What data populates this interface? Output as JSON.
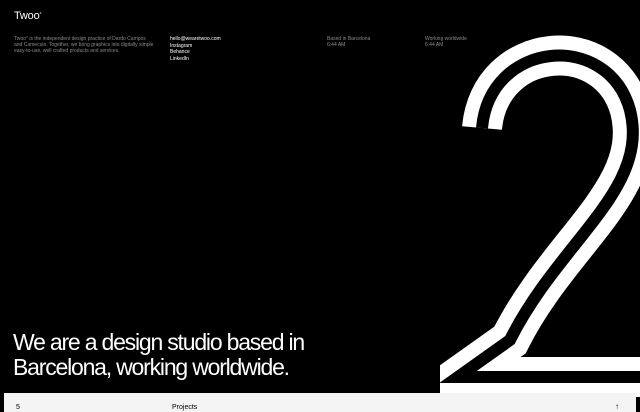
{
  "brand": {
    "name": "Twoo",
    "mark": "°"
  },
  "about": "Twoo° is the independent design practice of Dardo Campos and Camecuin. Together, we bring graphics into digitally simple easy-to-use, well crafted products and services.",
  "contacts": [
    "hello@wearetwoo.com",
    "Instagram",
    "Behance",
    "LinkedIn"
  ],
  "location": {
    "label": "Based in Barcelona",
    "time": "6:44 AM"
  },
  "worldwide": {
    "label": "Working worldwide",
    "time": "6:44 AM"
  },
  "hero": {
    "line1": "We are a design studio based in",
    "line2": "Barcelona, working worldwide."
  },
  "footer": {
    "count": "5",
    "label": "Projects",
    "arrow": "↑"
  },
  "colors": {
    "background": "#000000",
    "foreground": "#ffffff",
    "muted": "#8a8a8a",
    "bar": "#f4f4f4"
  }
}
